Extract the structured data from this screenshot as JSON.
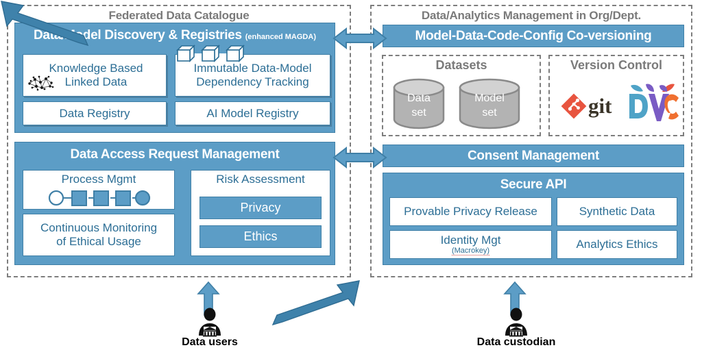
{
  "left_panel": {
    "title": "Federated Data Catalogue",
    "discovery": {
      "title": "Data/Model Discovery & Registries",
      "title_sub": "(enhanced MAGDA)",
      "cards": [
        {
          "label": "Knowledge Based\nLinked Data",
          "icon": "knowledge-graph-icon"
        },
        {
          "label": "Immutable Data-Model\nDependency Tracking",
          "icon": "blockchain-cubes-icon"
        },
        {
          "label": "Data Registry",
          "icon": ""
        },
        {
          "label": "AI Model Registry",
          "icon": ""
        }
      ]
    },
    "access": {
      "title": "Data Access Request Management",
      "process_mgmt": "Process Mgmt",
      "process_icon": "process-flow-icon",
      "continuous_monitoring": "Continuous Monitoring\nof Ethical Usage",
      "risk_assessment": "Risk Assessment",
      "risk_chips": [
        "Privacy",
        "Ethics"
      ]
    }
  },
  "right_panel": {
    "title": "Data/Analytics Management in Org/Dept.",
    "coversioning": "Model-Data-Code-Config Co-versioning",
    "datasets": {
      "title": "Datasets",
      "cylinders": [
        "Data\nset",
        "Model\nset"
      ]
    },
    "version_control": {
      "title": "Version Control",
      "logos": [
        "git-logo",
        "dvc-logo"
      ],
      "git_text": "git",
      "dvc_text": "DVC"
    },
    "consent": "Consent Management",
    "secure_api": {
      "title": "Secure API",
      "cards": [
        {
          "label": "Provable Privacy Release",
          "sub": ""
        },
        {
          "label": "Synthetic Data",
          "sub": ""
        },
        {
          "label": "Identity Mgt",
          "sub": "(Macrokey)"
        },
        {
          "label": "Analytics Ethics",
          "sub": ""
        }
      ]
    }
  },
  "actors": [
    {
      "label": "Data users",
      "icon": "user-institution-icon"
    },
    {
      "label": "Data custodian",
      "icon": "user-institution-icon"
    }
  ],
  "connectors": [
    {
      "name": "discovery-coversioning-link",
      "type": "double-arrow-horizontal"
    },
    {
      "name": "access-consent-link",
      "type": "double-arrow-horizontal"
    },
    {
      "name": "data-users-up-arrow",
      "type": "arrow-up"
    },
    {
      "name": "data-custodian-up-arrow",
      "type": "arrow-up"
    },
    {
      "name": "users-to-center-arrow",
      "type": "arrow-diagonal-up-right"
    },
    {
      "name": "custodian-to-center-arrow",
      "type": "arrow-diagonal-up-left"
    }
  ],
  "colors": {
    "blue": "#5c9dc6",
    "blue_border": "#3f7fa6",
    "text_blue": "#2c6e95",
    "gray": "#7a7a7a",
    "cylinder": "#b3b3b3",
    "git_red": "#e8543f",
    "dvc_teal": "#4fa3c7",
    "dvc_purple": "#7a5cc4",
    "dvc_orange": "#f07030"
  }
}
